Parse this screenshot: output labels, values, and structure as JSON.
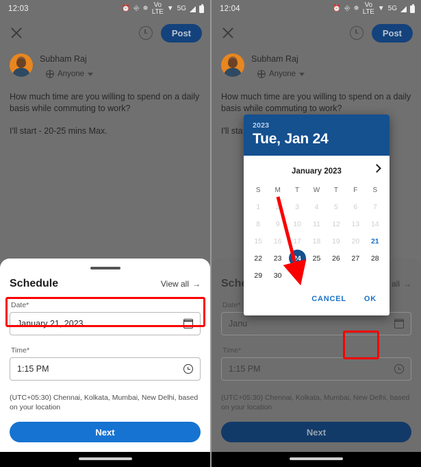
{
  "left_panel": {
    "status": {
      "time": "12:03",
      "icons": [
        "alarm-icon",
        "nfc-icon",
        "bluetooth-icon",
        "volte-icon",
        "wifi-icon",
        "5g-icon",
        "signal-icon",
        "battery-icon"
      ],
      "volte_label": "Vo\nLTE",
      "fiveg_label": "5G"
    },
    "appbar": {
      "close": "×",
      "post_label": "Post"
    },
    "author": {
      "name": "Subham Raj",
      "audience": "Anyone"
    },
    "post": {
      "line1": "How much time are you willing to spend on a daily basis while commuting to work?",
      "line2": "I'll start - 20-25 mins Max."
    },
    "sheet": {
      "title": "Schedule",
      "view_all": "View all",
      "date_label": "Date*",
      "date_value": "January 21, 2023",
      "time_label": "Time*",
      "time_value": "1:15 PM",
      "timezone": "(UTC+05:30) Chennai, Kolkata, Mumbai, New Delhi, based on your location",
      "next_label": "Next"
    }
  },
  "right_panel": {
    "status": {
      "time": "12:04"
    },
    "appbar": {
      "close": "×",
      "post_label": "Post"
    },
    "author": {
      "name": "Subham Raj",
      "audience": "Anyone"
    },
    "post": {
      "line1": "How much time are you willing to spend on a daily basis while commuting to work?",
      "line2_partial": "I'll sta"
    },
    "sheet": {
      "title_partial": "Sche",
      "view_all_partial": "all",
      "date_label": "Date*",
      "date_value_partial": "Janu",
      "time_label": "Time*",
      "time_value": "1:15 PM",
      "timezone": "(UTC+05:30) Chennai, Kolkata, Mumbai, New Delhi, based on your location",
      "next_label": "Next"
    },
    "dialog": {
      "year": "2023",
      "headline": "Tue, Jan 24",
      "month_label": "January 2023",
      "next_month_icon": "chevron-right-icon",
      "dow": [
        "S",
        "M",
        "T",
        "W",
        "T",
        "F",
        "S"
      ],
      "leading_blanks": 0,
      "days": [
        {
          "n": "1",
          "state": "disabled"
        },
        {
          "n": "2",
          "state": "disabled"
        },
        {
          "n": "3",
          "state": "disabled"
        },
        {
          "n": "4",
          "state": "disabled"
        },
        {
          "n": "5",
          "state": "disabled"
        },
        {
          "n": "6",
          "state": "disabled"
        },
        {
          "n": "7",
          "state": "disabled"
        },
        {
          "n": "8",
          "state": "disabled"
        },
        {
          "n": "9",
          "state": "disabled"
        },
        {
          "n": "10",
          "state": "disabled"
        },
        {
          "n": "11",
          "state": "disabled"
        },
        {
          "n": "12",
          "state": "disabled"
        },
        {
          "n": "13",
          "state": "disabled"
        },
        {
          "n": "14",
          "state": "disabled"
        },
        {
          "n": "15",
          "state": "disabled"
        },
        {
          "n": "16",
          "state": "disabled"
        },
        {
          "n": "17",
          "state": "disabled"
        },
        {
          "n": "18",
          "state": "disabled"
        },
        {
          "n": "19",
          "state": "disabled"
        },
        {
          "n": "20",
          "state": "disabled"
        },
        {
          "n": "21",
          "state": "today"
        },
        {
          "n": "22",
          "state": "normal"
        },
        {
          "n": "23",
          "state": "normal"
        },
        {
          "n": "24",
          "state": "selected"
        },
        {
          "n": "25",
          "state": "normal"
        },
        {
          "n": "26",
          "state": "normal"
        },
        {
          "n": "27",
          "state": "normal"
        },
        {
          "n": "28",
          "state": "normal"
        },
        {
          "n": "29",
          "state": "normal"
        },
        {
          "n": "30",
          "state": "normal"
        },
        {
          "n": "31",
          "state": "normal"
        }
      ],
      "cancel_label": "CANCEL",
      "ok_label": "OK"
    }
  },
  "colors": {
    "dialog_header": "#15508f",
    "selected_day": "#15508f",
    "today_text": "#1a73c8",
    "action_text": "#1a73c8",
    "next_button": "#1673d1",
    "post_button": "#14427c",
    "annotation": "#fb0000"
  }
}
